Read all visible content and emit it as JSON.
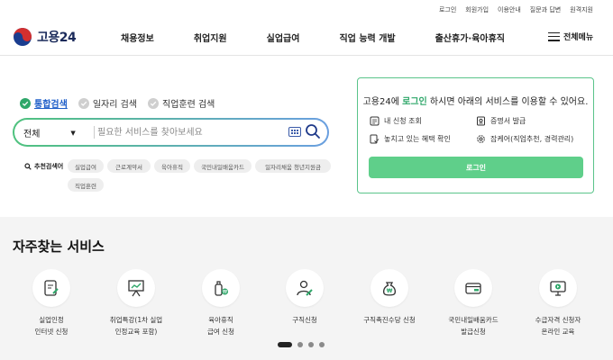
{
  "util_links": [
    "로그인",
    "회원가입",
    "이용안내",
    "질문과 답변",
    "원격지원"
  ],
  "logo": {
    "text": "고용24"
  },
  "nav": [
    "채용정보",
    "취업지원",
    "실업급여",
    "직업 능력 개발",
    "출산휴가·육아휴직"
  ],
  "menu_all": "전체메뉴",
  "search_tabs": [
    {
      "label": "통합검색",
      "active": true
    },
    {
      "label": "일자리 검색",
      "active": false
    },
    {
      "label": "직업훈련 검색",
      "active": false
    }
  ],
  "search": {
    "category": "전체",
    "placeholder": "필요한 서비스를 찾아보세요"
  },
  "recommended": {
    "label": "추천검색어",
    "chips": [
      "실업급여",
      "근로계약서",
      "육아휴직",
      "국민내일배움카드",
      "일자리채움 청년지원금",
      "직업훈련"
    ]
  },
  "panel": {
    "title_prefix": "고용24에 ",
    "title_link": "로그인",
    "title_suffix": " 하시면 아래의 서비스를 이용할 수 있어요.",
    "services": [
      "내 신청 조회",
      "증명서 발급",
      "놓치고 있는 혜택 확인",
      "잡케어(직업추천, 경력관리)"
    ],
    "login_button": "로그인"
  },
  "frequent": {
    "title": "자주찾는 서비스",
    "items": [
      {
        "line1": "실업인정",
        "line2": "인터넷 신청",
        "icon": "document-pen-icon"
      },
      {
        "line1": "취업특강(1차 실업",
        "line2": "인정교육 포함)",
        "icon": "presentation-board-icon"
      },
      {
        "line1": "육아휴직",
        "line2": "급여 신청",
        "icon": "baby-bottle-won-icon"
      },
      {
        "line1": "구직신청",
        "line2": "",
        "icon": "person-pen-icon"
      },
      {
        "line1": "구직촉진수당 신청",
        "line2": "",
        "icon": "money-bag-won-icon"
      },
      {
        "line1": "국민내일배움카드",
        "line2": "발급신청",
        "icon": "card-icon"
      },
      {
        "line1": "수급자격 신청자",
        "line2": "온라인 교육",
        "icon": "monitor-play-icon"
      }
    ]
  },
  "colors": {
    "accent_green": "#2fa76a",
    "button_green": "#5fcf8a",
    "link_blue": "#1f5fc9"
  }
}
